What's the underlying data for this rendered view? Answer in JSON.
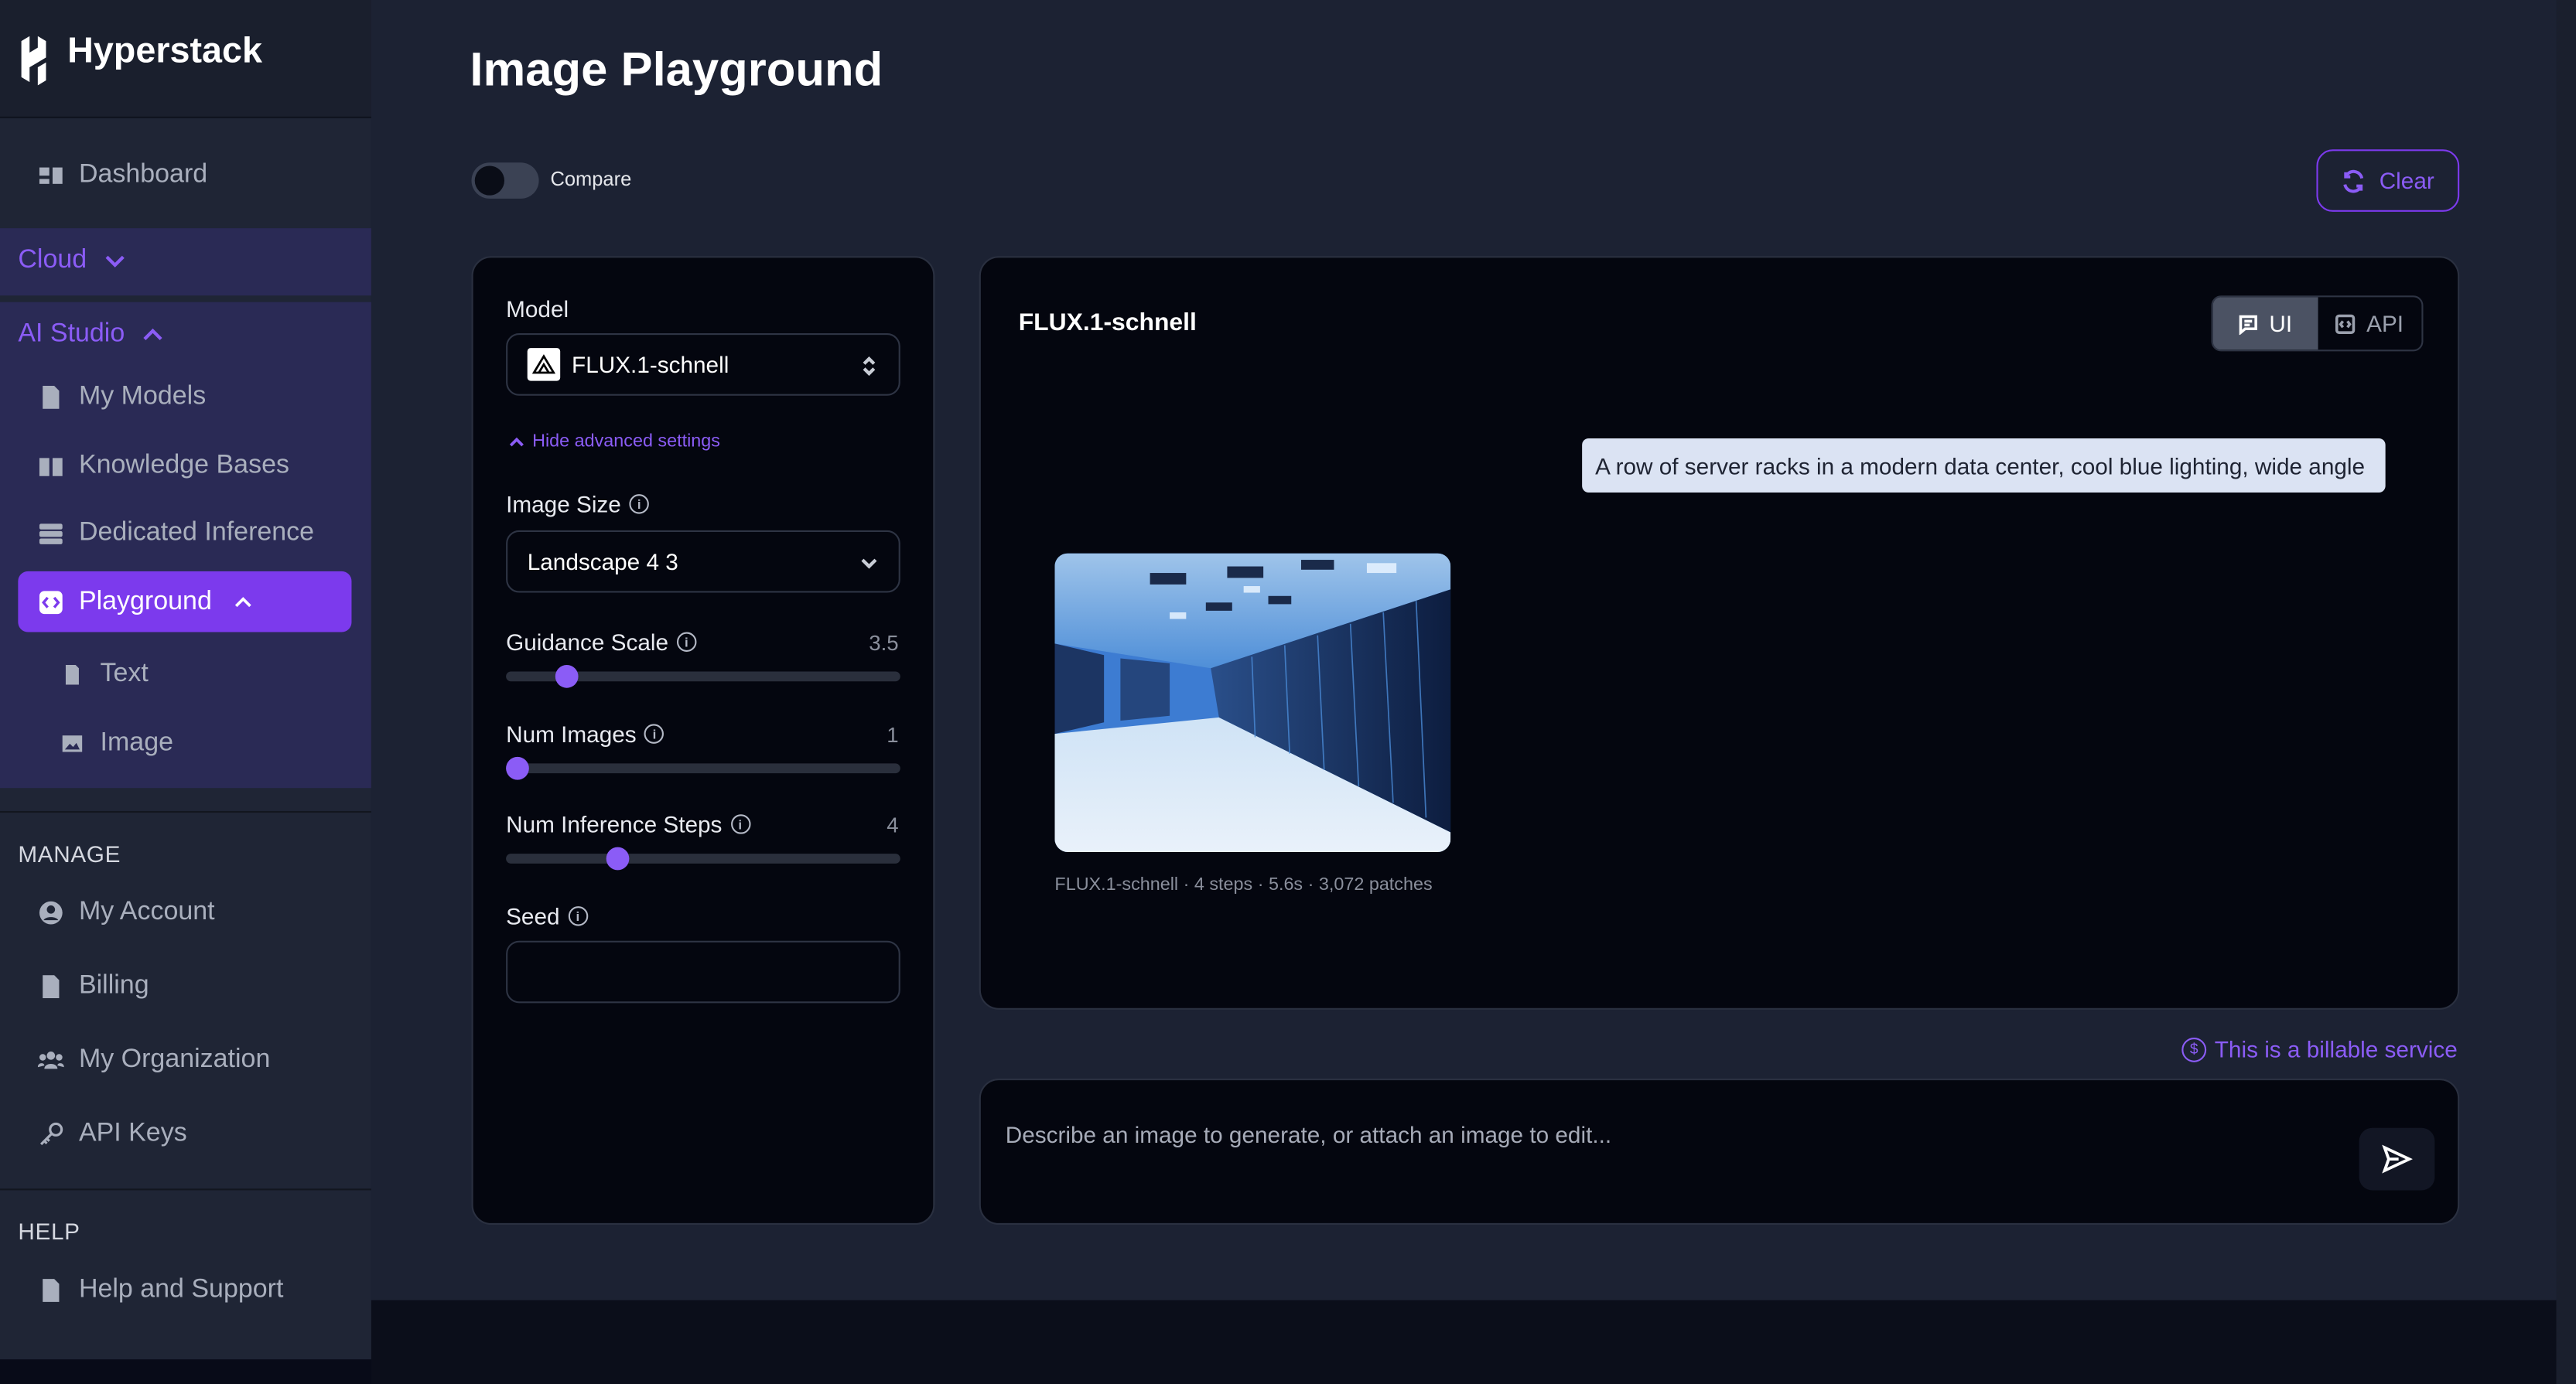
{
  "brand": {
    "name": "Hyperstack"
  },
  "sidebar": {
    "dashboard": "Dashboard",
    "cloud": "Cloud",
    "ai_studio": "AI Studio",
    "ai_items": [
      "My Models",
      "Knowledge Bases",
      "Dedicated Inference"
    ],
    "playground": "Playground",
    "playground_sub": [
      "Text",
      "Image"
    ],
    "manage_heading": "MANAGE",
    "manage_items": [
      "My Account",
      "Billing",
      "My Organization",
      "API Keys"
    ],
    "help_heading": "HELP",
    "help_items": [
      "Help and Support"
    ]
  },
  "page": {
    "title": "Image Playground",
    "compare_label": "Compare",
    "compare_on": false,
    "clear_label": "Clear"
  },
  "settings": {
    "model_label": "Model",
    "model_value": "FLUX.1-schnell",
    "advanced_toggle": "Hide advanced settings",
    "image_size_label": "Image Size",
    "image_size_value": "Landscape 4 3",
    "guidance_label": "Guidance Scale",
    "guidance_value": "3.5",
    "guidance_fraction": 0.155,
    "num_images_label": "Num Images",
    "num_images_value": "1",
    "num_images_fraction": 0.03,
    "steps_label": "Num Inference Steps",
    "steps_value": "4",
    "steps_fraction": 0.285,
    "seed_label": "Seed",
    "seed_value": ""
  },
  "chat": {
    "title": "FLUX.1-schnell",
    "mode_ui": "UI",
    "mode_api": "API",
    "active_mode": "UI",
    "prompt": "A row of server racks in a modern data center, cool blue lighting, wide angle",
    "image_meta": "FLUX.1-schnell · 4 steps · 5.6s · 3,072 patches"
  },
  "billable_note": "This is a billable service",
  "composer": {
    "placeholder": "Describe an image to generate, or attach an image to edit..."
  },
  "colors": {
    "accent": "#8b5cf6",
    "accent_strong": "#7c3aed",
    "sidebar_bg": "#1f2535",
    "main_bg": "#1c2233",
    "panel_bg": "#04060f"
  }
}
